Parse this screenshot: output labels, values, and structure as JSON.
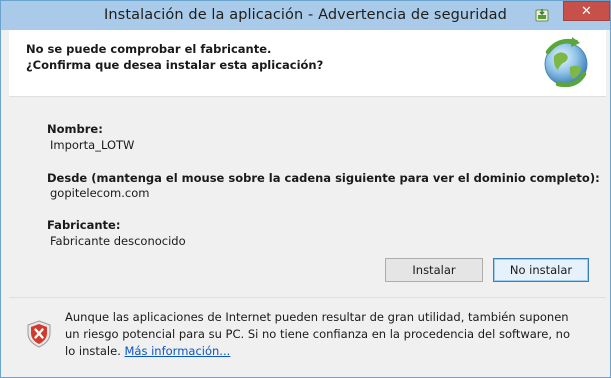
{
  "window": {
    "title": "Instalación de la aplicación - Advertencia de seguridad",
    "close_label": "✕"
  },
  "header": {
    "line1": "No se puede comprobar el fabricante.",
    "line2": "¿Confirma que desea instalar esta aplicación?",
    "icon": "globe-install-icon"
  },
  "details": {
    "name_label": "Nombre:",
    "name_value": "Importa_LOTW",
    "from_label": "Desde (mantenga el mouse sobre la cadena siguiente para ver el dominio completo):",
    "from_value": "gopitelecom.com",
    "publisher_label": "Fabricante:",
    "publisher_value": "Fabricante desconocido"
  },
  "buttons": {
    "install": "Instalar",
    "dont_install": "No instalar"
  },
  "footer": {
    "icon": "shield-error-icon",
    "warning_text": "Aunque las aplicaciones de Internet pueden resultar de gran utilidad, también suponen un riesgo potencial para su PC. Si no tiene confianza en la procedencia del software, no lo instale.",
    "more_info_link": "Más información..."
  },
  "colors": {
    "titlebar": "#a9cbe9",
    "close_button": "#c7504b",
    "link": "#0b55c4"
  }
}
